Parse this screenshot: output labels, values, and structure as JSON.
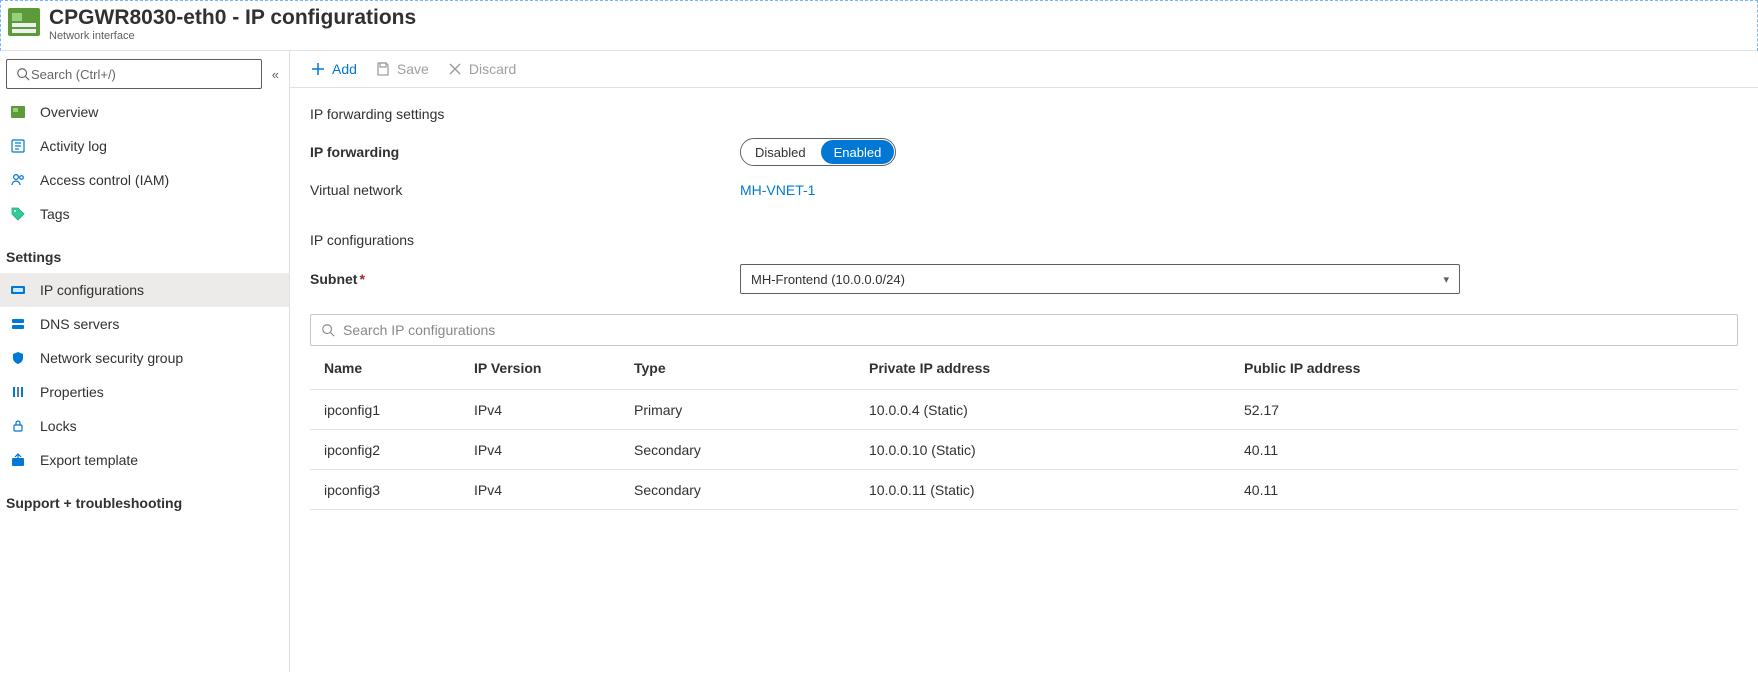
{
  "header": {
    "title": "CPGWR8030-eth0 - IP configurations",
    "subtitle": "Network interface"
  },
  "sidebar": {
    "search_placeholder": "Search (Ctrl+/)",
    "top_items": [
      {
        "name": "overview",
        "label": "Overview"
      },
      {
        "name": "activity-log",
        "label": "Activity log"
      },
      {
        "name": "access-control",
        "label": "Access control (IAM)"
      },
      {
        "name": "tags",
        "label": "Tags"
      }
    ],
    "groups": [
      {
        "title": "Settings",
        "items": [
          {
            "name": "ip-configurations",
            "label": "IP configurations",
            "active": true
          },
          {
            "name": "dns-servers",
            "label": "DNS servers"
          },
          {
            "name": "network-security-group",
            "label": "Network security group"
          },
          {
            "name": "properties",
            "label": "Properties"
          },
          {
            "name": "locks",
            "label": "Locks"
          },
          {
            "name": "export-template",
            "label": "Export template"
          }
        ]
      },
      {
        "title": "Support + troubleshooting",
        "items": []
      }
    ]
  },
  "toolbar": {
    "add_label": "Add",
    "save_label": "Save",
    "discard_label": "Discard"
  },
  "main": {
    "ip_forwarding_section_title": "IP forwarding settings",
    "ip_forwarding_label": "IP forwarding",
    "ip_forwarding_options": {
      "off": "Disabled",
      "on": "Enabled"
    },
    "ip_forwarding_value": "Enabled",
    "virtual_network_label": "Virtual network",
    "virtual_network_value": "MH-VNET-1",
    "ip_configurations_section_title": "IP configurations",
    "subnet_label": "Subnet",
    "subnet_value": "MH-Frontend (10.0.0.0/24)",
    "ip_search_placeholder": "Search IP configurations"
  },
  "table": {
    "headers": {
      "name": "Name",
      "ip_version": "IP Version",
      "type": "Type",
      "private_ip": "Private IP address",
      "public_ip": "Public IP address"
    },
    "rows": [
      {
        "name": "ipconfig1",
        "ip_version": "IPv4",
        "type": "Primary",
        "private_ip": "10.0.0.4 (Static)",
        "public_ip": "52.17"
      },
      {
        "name": "ipconfig2",
        "ip_version": "IPv4",
        "type": "Secondary",
        "private_ip": "10.0.0.10 (Static)",
        "public_ip": "40.11"
      },
      {
        "name": "ipconfig3",
        "ip_version": "IPv4",
        "type": "Secondary",
        "private_ip": "10.0.0.11 (Static)",
        "public_ip": "40.11"
      }
    ]
  }
}
